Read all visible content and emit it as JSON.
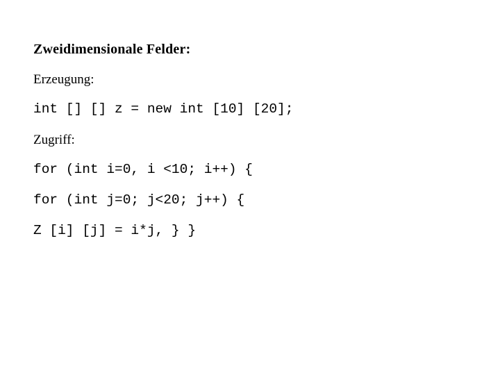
{
  "slide": {
    "background_color": "#ffffff",
    "text_color": "#000000",
    "heading": "Zweidimensionale Felder:",
    "sections": [
      {
        "label": "Erzeugung:",
        "code": [
          "int [] [] z = new int [10] [20];"
        ]
      },
      {
        "label": "Zugriff:",
        "code": [
          "for (int i=0, i <10; i++) {",
          "for (int j=0; j<20; j++) {",
          "Z [i] [j] = i*j, } }"
        ]
      }
    ]
  }
}
